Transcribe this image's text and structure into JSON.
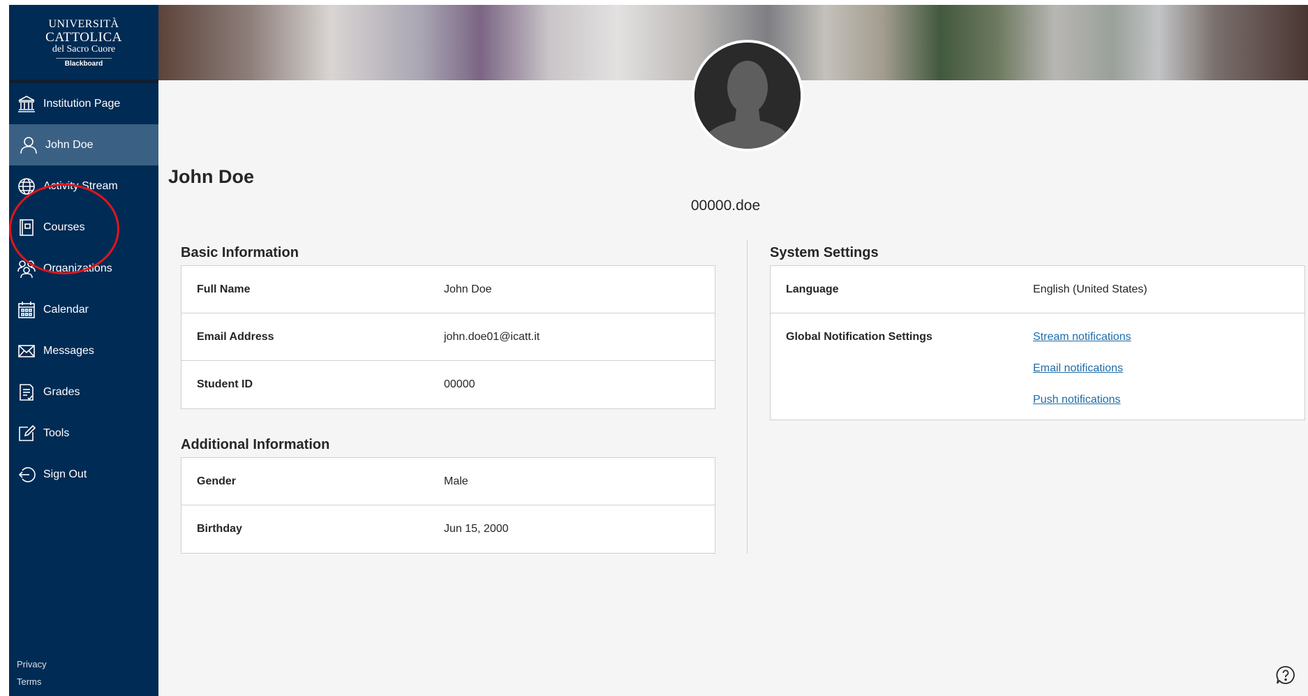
{
  "sidebar": {
    "logo": {
      "line1": "UNIVERSITÀ",
      "line2": "CATTOLICA",
      "line3": "del Sacro Cuore",
      "line4": "Blackboard"
    },
    "items": [
      {
        "label": "Institution Page",
        "icon": "institution-icon"
      },
      {
        "label": "John Doe",
        "icon": "user-icon",
        "active": true
      },
      {
        "label": "Activity Stream",
        "icon": "globe-icon"
      },
      {
        "label": "Courses",
        "icon": "courses-icon"
      },
      {
        "label": "Organizations",
        "icon": "organizations-icon"
      },
      {
        "label": "Calendar",
        "icon": "calendar-icon"
      },
      {
        "label": "Messages",
        "icon": "envelope-icon"
      },
      {
        "label": "Grades",
        "icon": "grades-icon"
      },
      {
        "label": "Tools",
        "icon": "tools-icon"
      },
      {
        "label": "Sign Out",
        "icon": "sign-out-icon"
      }
    ],
    "footer": {
      "privacy": "Privacy",
      "terms": "Terms"
    }
  },
  "profile": {
    "name": "John Doe",
    "username": "00000.doe"
  },
  "basic_info": {
    "title": "Basic Information",
    "rows": [
      {
        "label": "Full Name",
        "value": "John Doe"
      },
      {
        "label": "Email Address",
        "value": "john.doe01@icatt.it"
      },
      {
        "label": "Student ID",
        "value": "00000"
      }
    ]
  },
  "additional_info": {
    "title": "Additional Information",
    "rows": [
      {
        "label": "Gender",
        "value": "Male"
      },
      {
        "label": "Birthday",
        "value": "Jun 15, 2000"
      }
    ]
  },
  "system_settings": {
    "title": "System Settings",
    "language_label": "Language",
    "language_value": "English (United States)",
    "notifications_label": "Global Notification Settings",
    "notification_links": [
      "Stream notifications",
      "Email notifications",
      "Push notifications"
    ]
  },
  "colors": {
    "sidebar_bg": "#002b54",
    "sidebar_active": "#3a6184",
    "link": "#1e6ca9",
    "annotation": "#e0161d"
  }
}
